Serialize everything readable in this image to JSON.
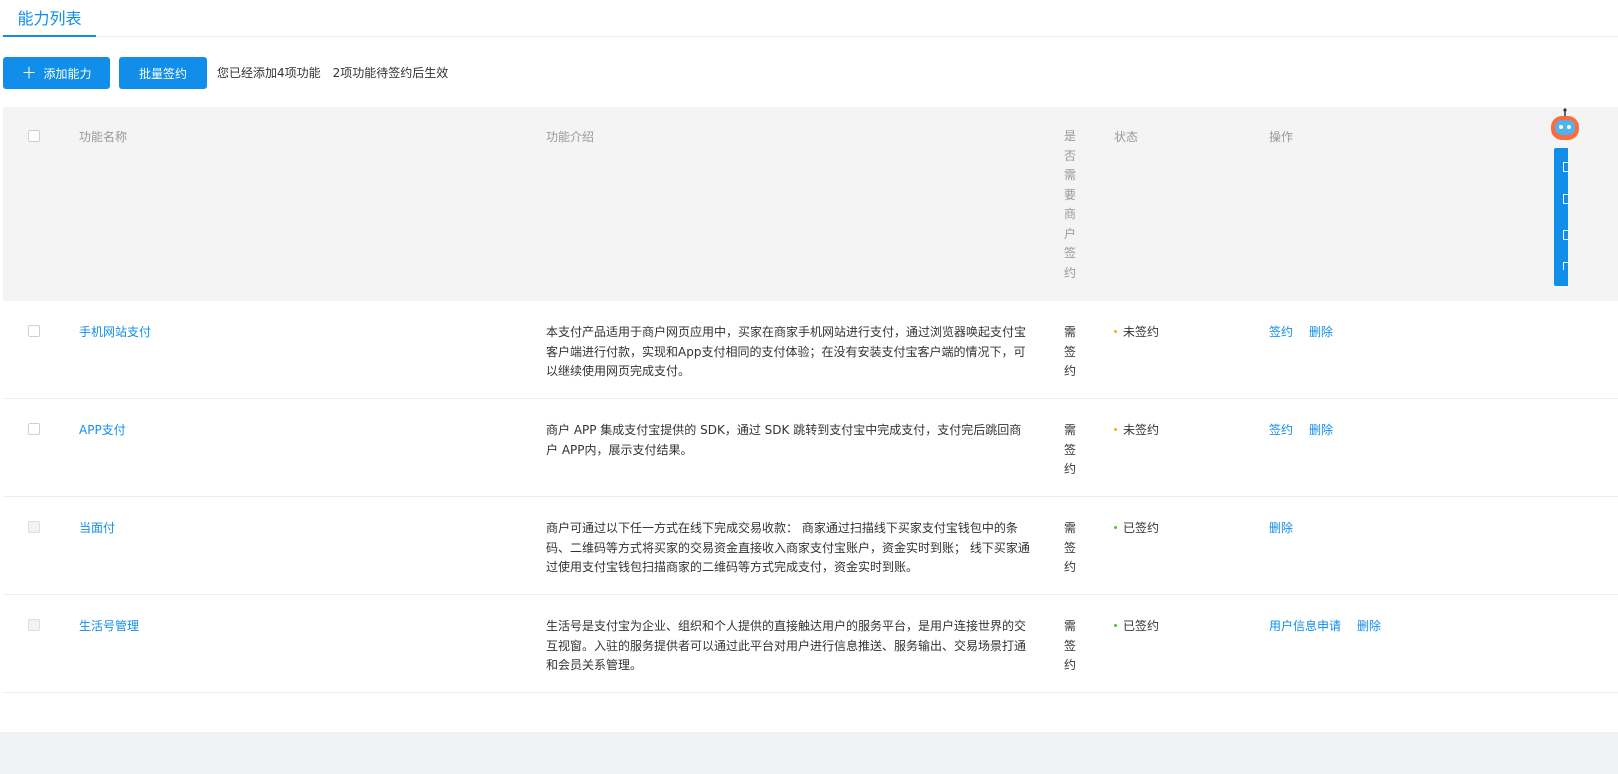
{
  "tab": {
    "label": "能力列表"
  },
  "toolbar": {
    "add_label": "添加能力",
    "batch_label": "批量签约",
    "hint_added": "您已经添加4项功能",
    "hint_pending": "2项功能待签约后生效"
  },
  "table": {
    "headers": {
      "name": "功能名称",
      "desc": "功能介绍",
      "need": "是否需要商户签约",
      "status": "状态",
      "ops": "操作"
    },
    "rows": [
      {
        "name": "手机网站支付",
        "desc": "本支付产品适用于商户网页应用中，买家在商家手机网站进行支付，通过浏览器唤起支付宝客户端进行付款，实现和App支付相同的支付体验；在没有安装支付宝客户端的情况下，可以继续使用网页完成支付。",
        "need": "需签约",
        "status": "未签约",
        "status_color": "#faad14",
        "checkbox_disabled": false,
        "actions": [
          "签约",
          "删除"
        ]
      },
      {
        "name": "APP支付",
        "desc": "商户 APP 集成支付宝提供的 SDK，通过 SDK 跳转到支付宝中完成支付，支付完后跳回商户 APP内，展示支付结果。",
        "need": "需签约",
        "status": "未签约",
        "status_color": "#faad14",
        "checkbox_disabled": false,
        "actions": [
          "签约",
          "删除"
        ]
      },
      {
        "name": "当面付",
        "desc": "商户可通过以下任一方式在线下完成交易收款： 商家通过扫描线下买家支付宝钱包中的条码、二维码等方式将买家的交易资金直接收入商家支付宝账户，资金实时到账； 线下买家通过使用支付宝钱包扫描商家的二维码等方式完成支付，资金实时到账。",
        "need": "需签约",
        "status": "已签约",
        "status_color": "#52c41a",
        "checkbox_disabled": true,
        "actions": [
          "删除"
        ]
      },
      {
        "name": "生活号管理",
        "desc": "生活号是支付宝为企业、组织和个人提供的直接触达用户的服务平台，是用户连接世界的交互视窗。入驻的服务提供者可以通过此平台对用户进行信息推送、服务输出、交易场景打通和会员关系管理。",
        "need": "需签约",
        "status": "已签约",
        "status_color": "#52c41a",
        "checkbox_disabled": true,
        "actions": [
          "用户信息申请",
          "删除"
        ]
      }
    ]
  },
  "colors": {
    "primary": "#108ee9",
    "header_bg": "#f4f4f4",
    "footer_bg": "#f0f2f5"
  },
  "icons": {
    "add": "plus-icon",
    "assistant": "robot-icon"
  }
}
